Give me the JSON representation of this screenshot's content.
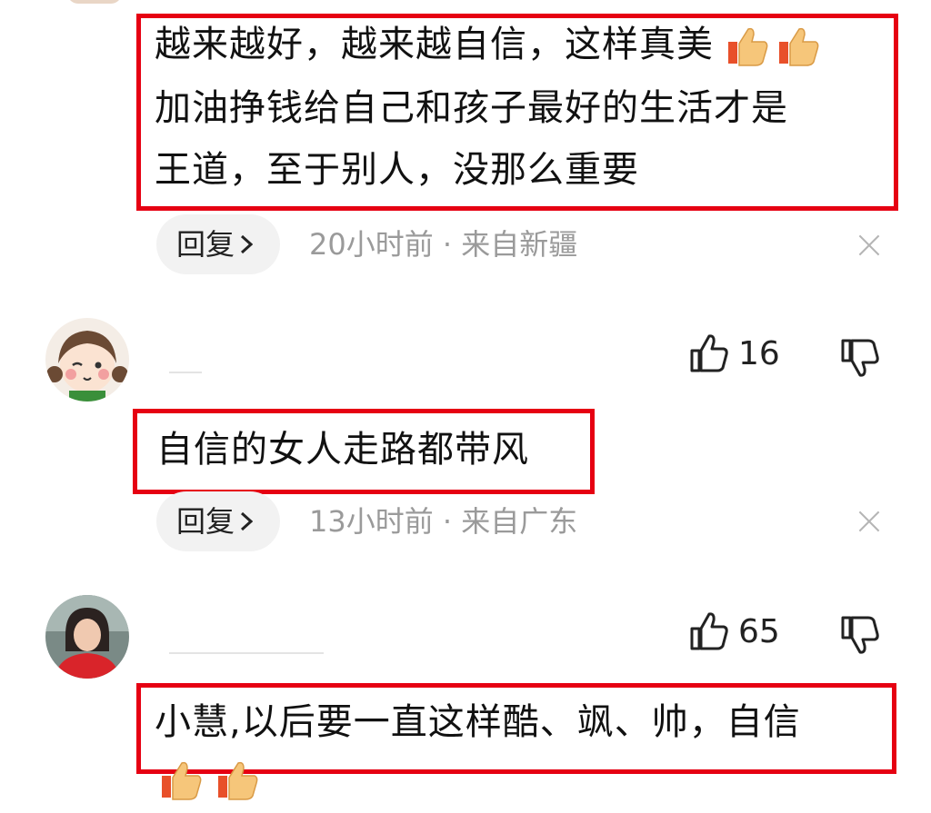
{
  "comments": [
    {
      "text_lines": [
        "越来越好，越来越自信，这样真美",
        "加油挣钱给自己和孩子最好的生活才是",
        "王道，至于别人，没那么重要"
      ],
      "reply_label": "回复",
      "meta": "20小时前 · 来自新疆"
    },
    {
      "likes": "16",
      "text_lines": [
        "自信的女人走路都带风"
      ],
      "reply_label": "回复",
      "meta": "13小时前 · 来自广东"
    },
    {
      "likes": "65",
      "text_lines": [
        "小慧,以后要一直这样酷、飒、帅，自信"
      ]
    }
  ],
  "colors": {
    "highlight": "#e60012",
    "meta": "#9a9a9a",
    "reply_bg": "#f2f2f2"
  },
  "icons": [
    "thumbs-up-emoji",
    "like-icon",
    "dislike-icon",
    "close-icon",
    "chevron-right-icon"
  ]
}
